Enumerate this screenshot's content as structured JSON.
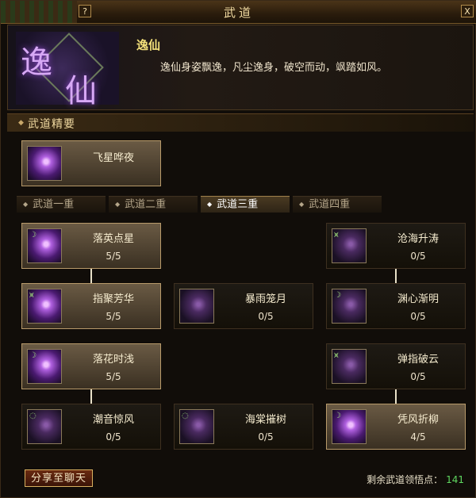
{
  "window": {
    "title": "武道",
    "help_label": "?",
    "close_label": "X"
  },
  "header": {
    "emblem_char1": "逸",
    "emblem_char2": "仙",
    "sect_name": "逸仙",
    "sect_desc": "逸仙身姿飘逸，凡尘逸身，破空而动，飒踏如风。"
  },
  "essence": {
    "title": "武道精要",
    "skill": {
      "name": "飞星哗夜",
      "icon": "ninja-silhouette-icon"
    }
  },
  "tabs": [
    {
      "label": "武道一重"
    },
    {
      "label": "武道二重"
    },
    {
      "label": "武道三重",
      "active": true
    },
    {
      "label": "武道四重"
    }
  ],
  "skills": [
    {
      "name": "落英点星",
      "level": "5/5",
      "icon": "feather-swirl-icon"
    },
    {
      "name": "沧海升涛",
      "level": "0/5",
      "icon": "blade-slash-icon"
    },
    {
      "name": "指聚芳华",
      "level": "5/5",
      "icon": "feather-swirl-icon"
    },
    {
      "name": "暴雨笼月",
      "level": "0/5",
      "icon": "piano-keys-icon"
    },
    {
      "name": "渊心渐明",
      "level": "0/5",
      "icon": "crystal-figure-icon"
    },
    {
      "name": "落花时浅",
      "level": "5/5",
      "icon": "feather-swirl-icon"
    },
    {
      "name": "弹指破云",
      "level": "0/5",
      "icon": "feather-swirl-icon"
    },
    {
      "name": "潮音惊风",
      "level": "0/5",
      "icon": "feather-swirl-icon"
    },
    {
      "name": "海棠摧树",
      "level": "0/5",
      "icon": "feather-swirl-icon"
    },
    {
      "name": "凭风折柳",
      "level": "4/5",
      "icon": "feather-swirl-icon"
    }
  ],
  "footer": {
    "share_label": "分享至聊天",
    "remain_label": "剩余武道领悟点：",
    "remain_value": "141"
  },
  "colors": {
    "accent_gold": "#f3e07a",
    "points_green": "#5fd860"
  }
}
